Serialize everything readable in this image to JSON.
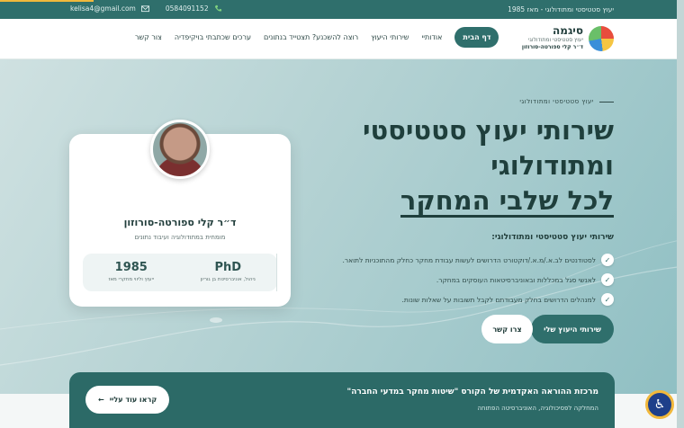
{
  "topbar": {
    "tagline": "יעוץ סטטיסטי ומתודולוגי - מאז 1985",
    "phone": "0584091152",
    "email": "kelisa4@gmail.com"
  },
  "logo": {
    "name": "סיגמה",
    "subtitle": "יעוץ סטטיסטי ומתודולוגי",
    "owner": "ד״ר קלי ספורטה-סורוזון"
  },
  "nav": {
    "items": [
      "דף הבית",
      "אודותיי",
      "שירותי היעוץ",
      "רוצה להשכנע? תצטייד בנתונים",
      "ערכים שכתבתי בויקיפדיה",
      "צור קשר"
    ]
  },
  "hero": {
    "eyebrow": "יעוץ סטטיסטי ומתודולוגי",
    "headline_line1": "שירותי יעוץ סטטיסטי",
    "headline_line2": "ומתודולוגי",
    "headline_line3": "לכל שלבי המחקר",
    "services_title": "שירותי יעוץ סטטיסטי ומתודולוגי:",
    "services": [
      "לסטודנטים לב.א./מ.א./דוקטורט הדרושים לעשות עבודת מחקר כחלק מהתוכניות לתואר.",
      "לאנשי סגל במכללות ובאוניברסיטאות העוסקים במחקר.",
      "למנהלים הדרושים בחלק מעבודתם לקבל תשובות על שאלות שונות."
    ],
    "primary_button": "שירותי היעוץ שלי",
    "secondary_button": "צרו קשר"
  },
  "profile": {
    "name": "ד״ר קלי ספורטה-סורוזון",
    "role": "מומחית במתודולוגיה ועיבוד נתונים",
    "stats": [
      {
        "value": "1985",
        "label": "ייעוץ וליווי מחקרי מאז"
      },
      {
        "value": "PhD",
        "label": "ניהול, אוניברסיטת בן גוריון"
      }
    ]
  },
  "banner": {
    "title": "מרכזת ההוראה האקדמית של הקורס \"שיטות מחקר במדעי החברה\"",
    "subtitle": "המחלקה לפסיכולוגיה, האוניברסיטה הפתוחה",
    "button": "קראו עוד עליי"
  },
  "colors": {
    "primary": "#2f6f6c",
    "accent": "#f1b83c",
    "heading": "#1f3f3c"
  },
  "icons": {
    "phone": "phone-icon",
    "email": "mail-icon",
    "check": "check-icon",
    "arrow": "arrow-left-icon",
    "accessibility": "accessibility-icon"
  }
}
